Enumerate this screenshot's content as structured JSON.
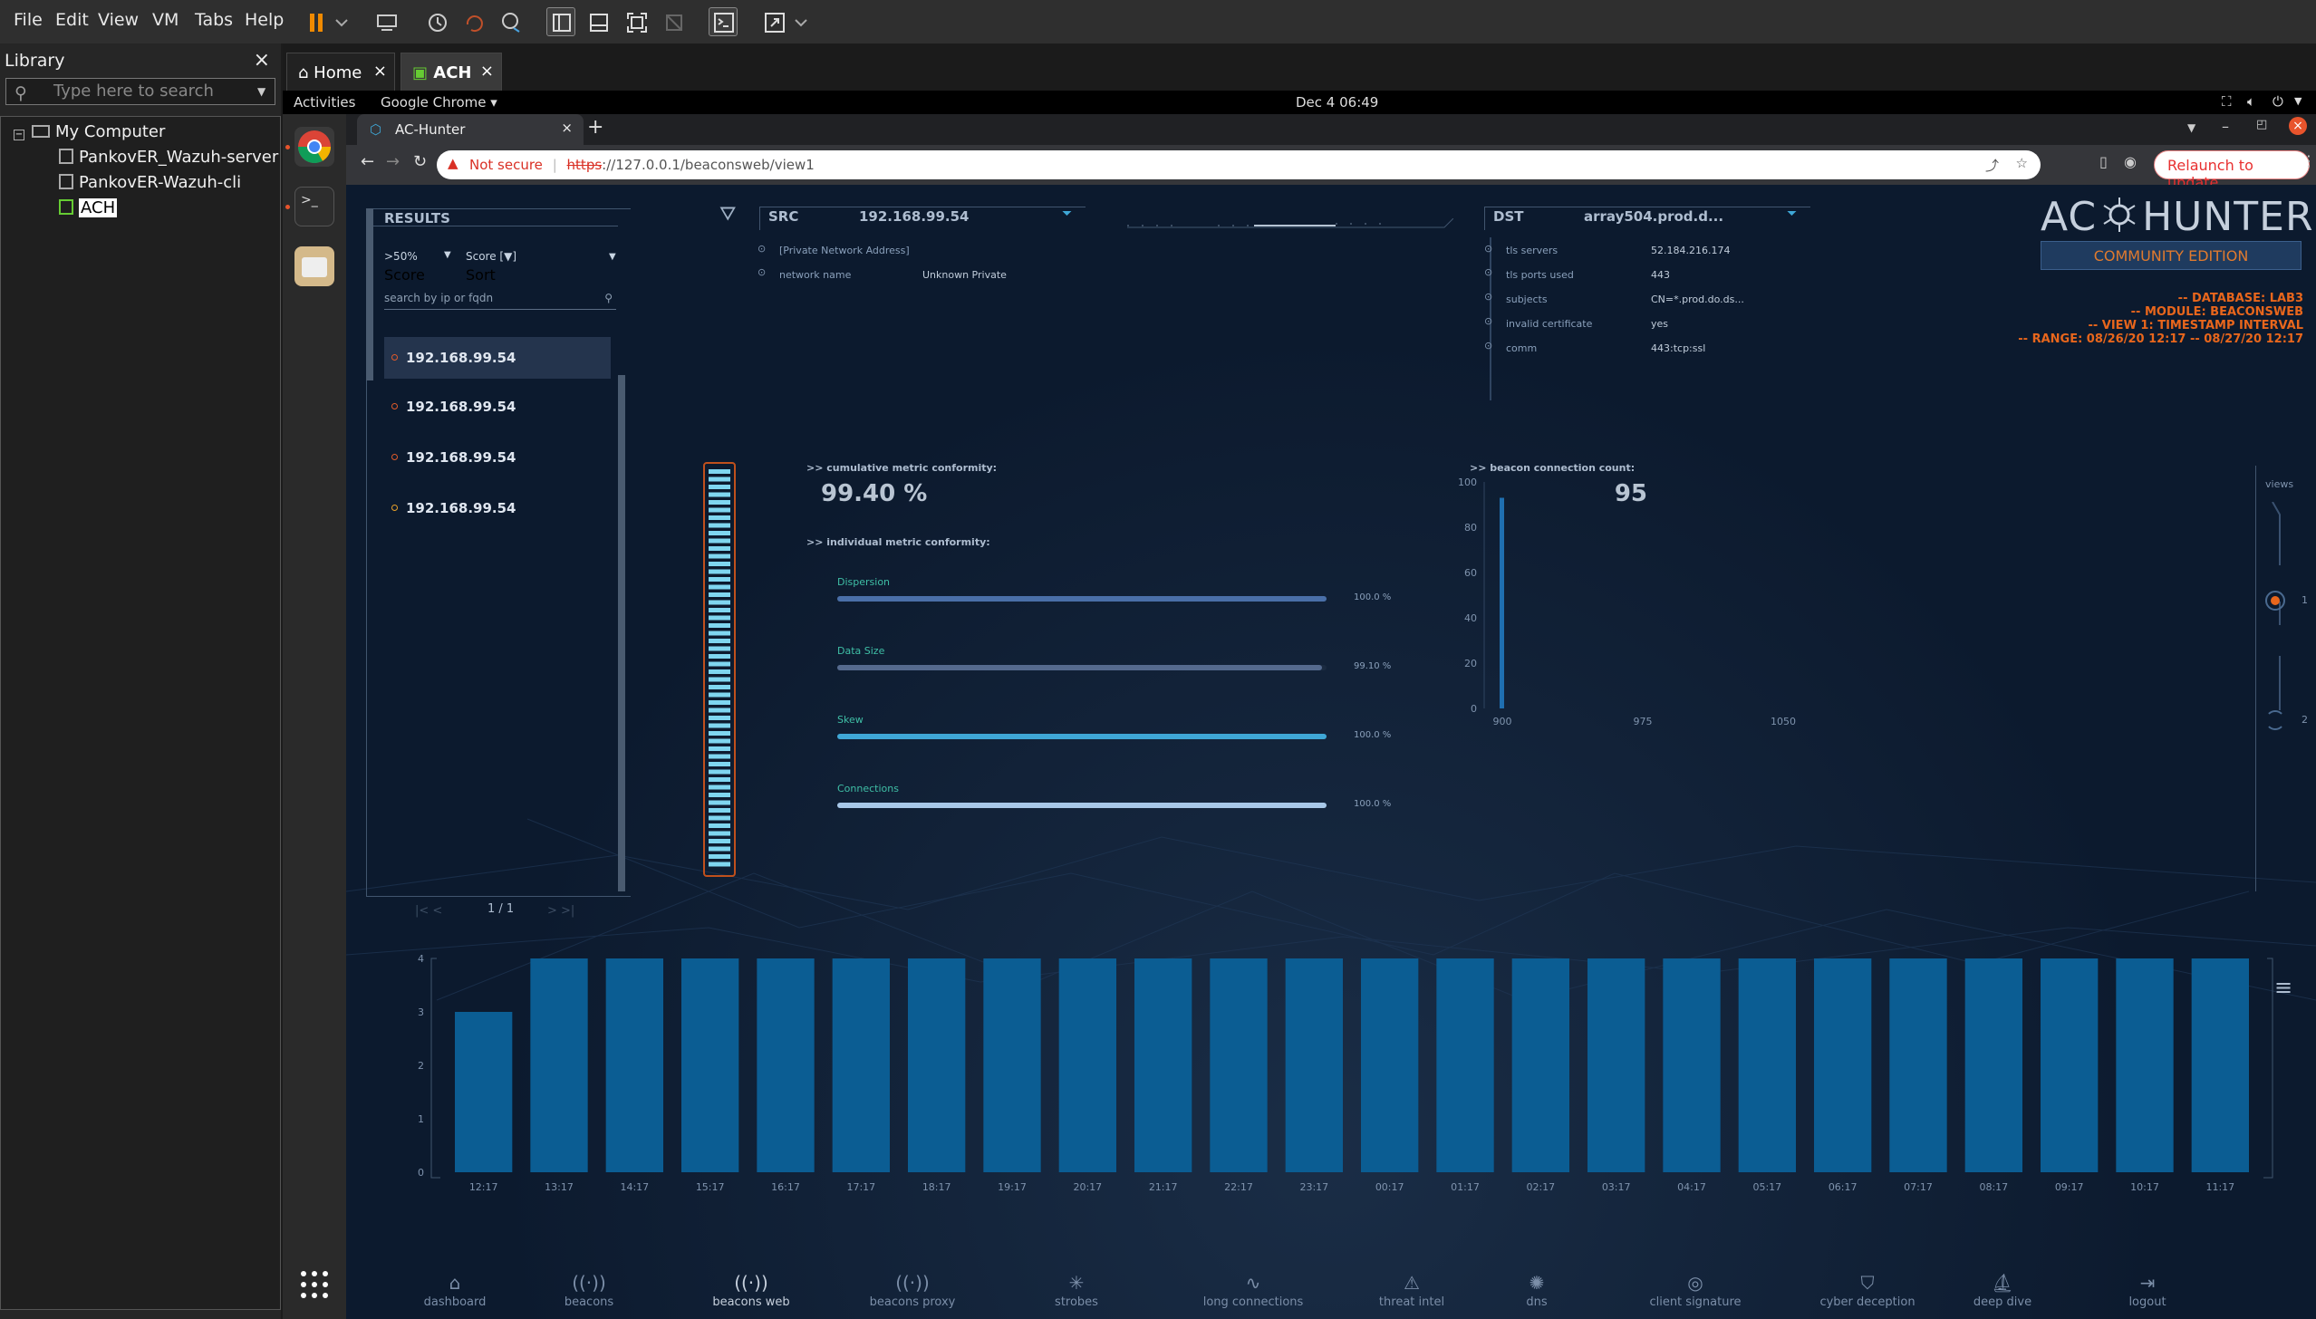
{
  "vmware": {
    "menu": [
      "File",
      "Edit",
      "View",
      "VM",
      "Tabs",
      "Help"
    ],
    "library": {
      "title": "Library",
      "search_placeholder": "Type here to search",
      "root": "My Computer",
      "vms": [
        "PankovER_Wazuh-server",
        "PankovER-Wazuh-cli",
        "ACH"
      ]
    },
    "tabs": [
      "Home",
      "ACH"
    ]
  },
  "ubuntu": {
    "activities": "Activities",
    "app": "Google Chrome ▾",
    "clock": "Dec 4  06:49"
  },
  "chrome": {
    "tab_title": "AC-Hunter",
    "not_secure": "Not secure",
    "url_scheme": "https",
    "url_rest": "://127.0.0.1/beaconsweb/view1",
    "relaunch": "Relaunch to update"
  },
  "app": {
    "results": {
      "title": "RESULTS",
      "filter": ">50%",
      "filter_sub": "Score",
      "sort": "Score [▼]",
      "sort_sub": "Sort",
      "search_placeholder": "search by ip or fqdn",
      "items": [
        "192.168.99.54",
        "192.168.99.54",
        "192.168.99.54",
        "192.168.99.54"
      ],
      "page": "1 / 1"
    },
    "src": {
      "label": "SRC",
      "ip": "192.168.99.54",
      "rows": [
        {
          "k": "[Private Network Address]",
          "v": ""
        },
        {
          "k": "network name",
          "v": "Unknown Private"
        }
      ]
    },
    "dst": {
      "label": "DST",
      "host": "array504.prod.d...",
      "rows": [
        {
          "k": "tls servers",
          "v": "52.184.216.174"
        },
        {
          "k": "tls ports used",
          "v": "443"
        },
        {
          "k": "subjects",
          "v": "CN=*.prod.do.ds..."
        },
        {
          "k": "invalid certificate",
          "v": "yes"
        },
        {
          "k": "comm",
          "v": "443:tcp:ssl"
        }
      ]
    },
    "brand": {
      "name_left": "AC",
      "name_right": "HUNTER",
      "edition": "COMMUNITY EDITION",
      "info": [
        "-- DATABASE: LAB3",
        "-- MODULE: BEACONSWEB",
        "-- VIEW 1: TIMESTAMP INTERVAL",
        "-- RANGE: 08/26/20 12:17 -- 08/27/20 12:17"
      ]
    },
    "metrics": {
      "cumulative_label": ">> cumulative metric conformity:",
      "cumulative": "99.40 %",
      "count_label": ">> beacon connection count:",
      "count": "95",
      "individual_label": ">> individual metric conformity:",
      "items": [
        {
          "name": "Dispersion",
          "pct": "100.0 %",
          "value": 1.0,
          "color": "#4a6fa8"
        },
        {
          "name": "Data Size",
          "pct": "99.10 %",
          "value": 0.991,
          "color": "#556a8e"
        },
        {
          "name": "Skew",
          "pct": "100.0 %",
          "value": 1.0,
          "color": "#3fa7d6"
        },
        {
          "name": "Connections",
          "pct": "100.0 %",
          "value": 1.0,
          "color": "#a8c8e8"
        }
      ]
    },
    "views": {
      "label": "views",
      "v1": "1",
      "v2": "2"
    },
    "nav": [
      "dashboard",
      "beacons",
      "beacons web",
      "beacons proxy",
      "strobes",
      "long connections",
      "threat intel",
      "dns",
      "client signature",
      "cyber deception",
      "deep dive",
      "logout"
    ]
  },
  "chart_data": [
    {
      "type": "bar",
      "title": "",
      "xlabel": "",
      "ylabel": "",
      "x_ticks": [
        "900",
        "975",
        "1050"
      ],
      "y_ticks": [
        "0",
        "20",
        "40",
        "60",
        "80",
        "100"
      ],
      "ylim": [
        0,
        100
      ],
      "series": [
        {
          "x": [
            900
          ],
          "values": [
            93
          ]
        }
      ]
    },
    {
      "type": "bar",
      "title": "",
      "xlabel": "",
      "ylabel": "",
      "categories": [
        "12:17",
        "13:17",
        "14:17",
        "15:17",
        "16:17",
        "17:17",
        "18:17",
        "19:17",
        "20:17",
        "21:17",
        "22:17",
        "23:17",
        "00:17",
        "01:17",
        "02:17",
        "03:17",
        "04:17",
        "05:17",
        "06:17",
        "07:17",
        "08:17",
        "09:17",
        "10:17",
        "11:17"
      ],
      "values": [
        3,
        4,
        4,
        4,
        4,
        4,
        4,
        4,
        4,
        4,
        4,
        4,
        4,
        4,
        4,
        4,
        4,
        4,
        4,
        4,
        4,
        4,
        4,
        4
      ],
      "ylim": [
        0,
        4
      ],
      "y_ticks": [
        "0",
        "1",
        "2",
        "3",
        "4"
      ]
    }
  ]
}
